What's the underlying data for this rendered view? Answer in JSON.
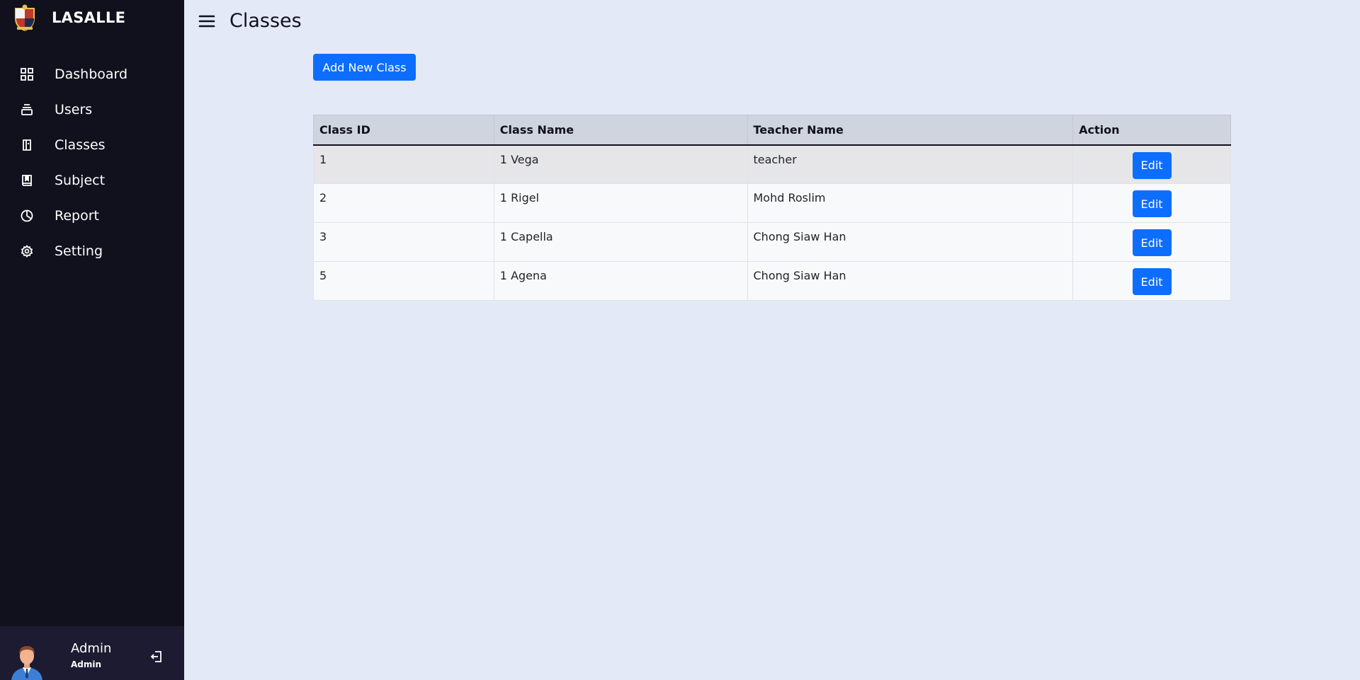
{
  "sidebar": {
    "brand": "LASALLE",
    "items": [
      {
        "label": "Dashboard",
        "icon": "grid-icon"
      },
      {
        "label": "Users",
        "icon": "users-icon"
      },
      {
        "label": "Classes",
        "icon": "classes-icon"
      },
      {
        "label": "Subject",
        "icon": "book-icon"
      },
      {
        "label": "Report",
        "icon": "pie-chart-icon"
      },
      {
        "label": "Setting",
        "icon": "gear-icon"
      }
    ],
    "profile": {
      "name": "Admin",
      "job": "Admin"
    }
  },
  "header": {
    "title": "Classes"
  },
  "main": {
    "add_button_label": "Add New Class",
    "table": {
      "columns": [
        "Class ID",
        "Class Name",
        "Teacher Name",
        "Action"
      ],
      "rows": [
        {
          "id": "1",
          "name": "1 Vega",
          "teacher": "teacher",
          "action": "Edit"
        },
        {
          "id": "2",
          "name": "1 Rigel",
          "teacher": "Mohd Roslim",
          "action": "Edit"
        },
        {
          "id": "3",
          "name": "1 Capella",
          "teacher": "Chong Siaw Han",
          "action": "Edit"
        },
        {
          "id": "5",
          "name": "1 Agena",
          "teacher": "Chong Siaw Han",
          "action": "Edit"
        }
      ]
    }
  },
  "colors": {
    "sidebar_bg": "#11101d",
    "page_bg": "#e4e9f7",
    "accent": "#0d6efd"
  }
}
